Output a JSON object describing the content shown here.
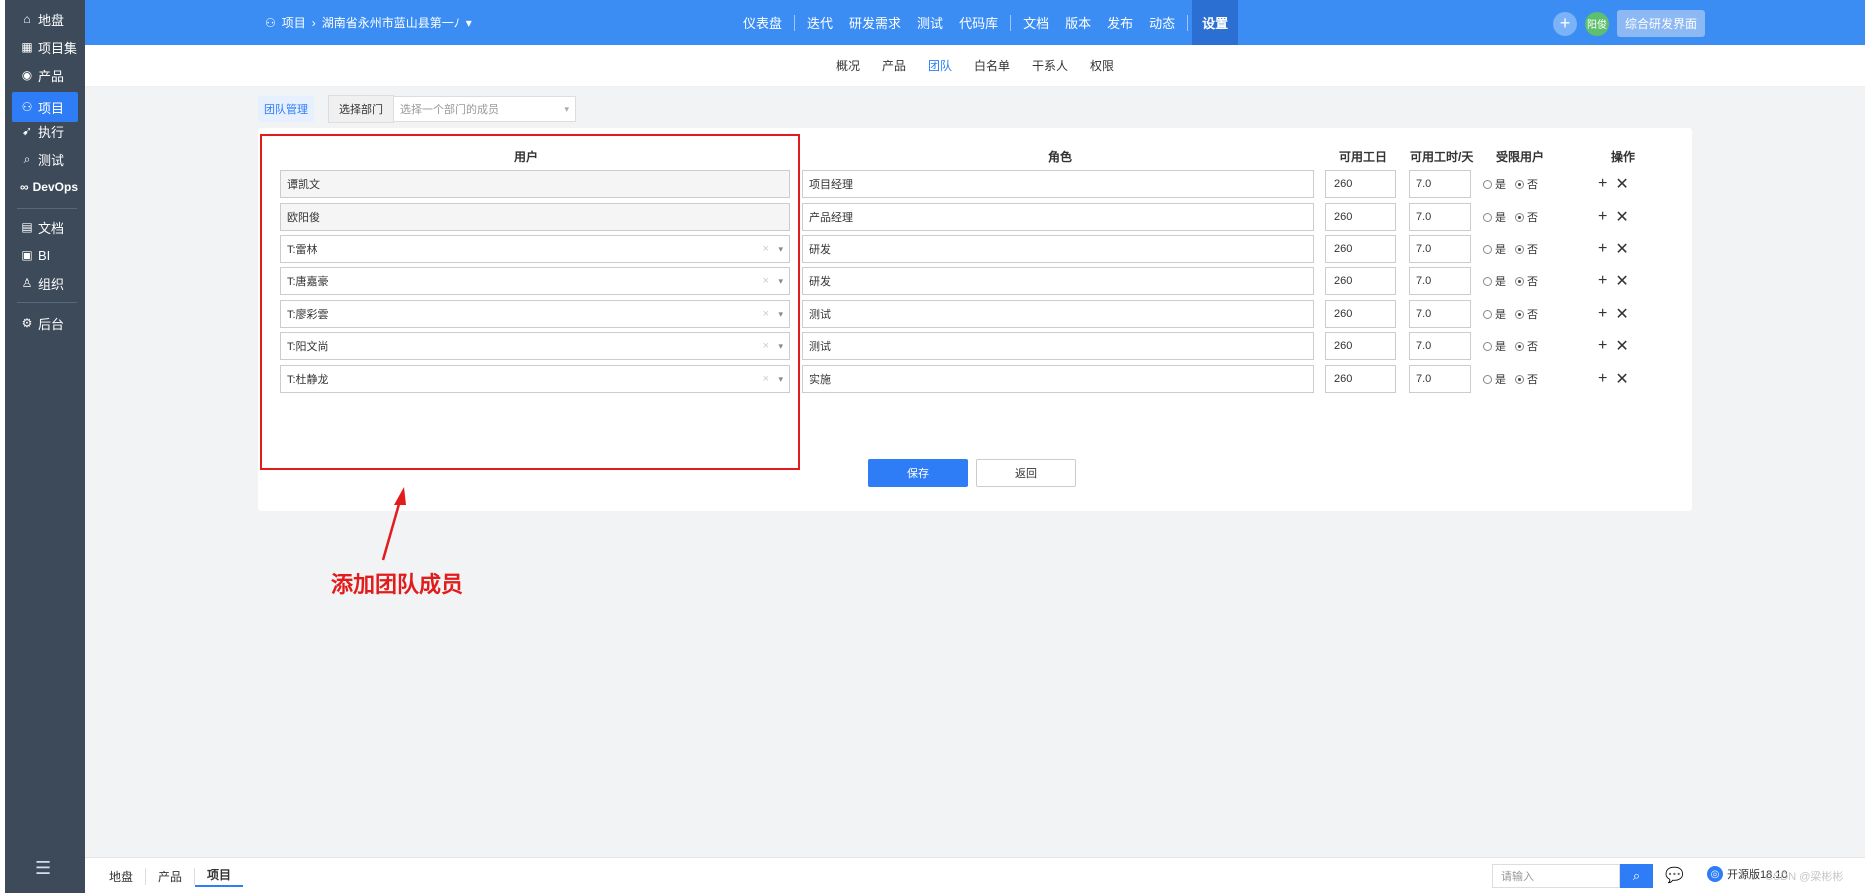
{
  "sidebar": {
    "items": [
      {
        "label": "地盘",
        "icon": "home-icon"
      },
      {
        "label": "项目集",
        "icon": "grid-icon"
      },
      {
        "label": "产品",
        "icon": "location-icon"
      },
      {
        "label": "项目",
        "icon": "project-icon"
      },
      {
        "label": "执行",
        "icon": "run-icon"
      },
      {
        "label": "测试",
        "icon": "search-icon"
      },
      {
        "label": "DevOps",
        "icon": "infinity-icon"
      },
      {
        "label": "文档",
        "icon": "document-icon"
      },
      {
        "label": "BI",
        "icon": "chart-icon"
      },
      {
        "label": "组织",
        "icon": "user-group-icon"
      },
      {
        "label": "后台",
        "icon": "gear-icon"
      }
    ],
    "active": "项目"
  },
  "header": {
    "breadcrumb_root": "项目",
    "breadcrumb_current": "湖南省永州市蓝山县第一ﾉ",
    "nav_items": [
      "仪表盘",
      "迭代",
      "研发需求",
      "测试",
      "代码库",
      "文档",
      "版本",
      "发布",
      "动态",
      "设置"
    ],
    "avatar_text": "阳俊",
    "workspace_button": "综合研发界面"
  },
  "subnav": {
    "tabs": [
      "概况",
      "产品",
      "团队",
      "白名单",
      "干系人",
      "权限"
    ],
    "active": "团队"
  },
  "toolbar": {
    "team_mgmt": "团队管理",
    "dept_label": "选择部门",
    "dept_placeholder": "选择一个部门的成员"
  },
  "table": {
    "headers": {
      "user": "用户",
      "role": "角色",
      "days": "可用工日",
      "hours": "可用工时/天",
      "limited": "受限用户",
      "ops": "操作"
    },
    "yes_label": "是",
    "no_label": "否",
    "rows": [
      {
        "user": "谭凯文",
        "role": "项目经理",
        "days": "260",
        "hours": "7.0",
        "readonly": true
      },
      {
        "user": "欧阳俊",
        "role": "产品经理",
        "days": "260",
        "hours": "7.0",
        "readonly": true
      },
      {
        "user": "T:雷林",
        "role": "研发",
        "days": "260",
        "hours": "7.0",
        "readonly": false
      },
      {
        "user": "T:唐嘉豪",
        "role": "研发",
        "days": "260",
        "hours": "7.0",
        "readonly": false
      },
      {
        "user": "T:廖彩雲",
        "role": "测试",
        "days": "260",
        "hours": "7.0",
        "readonly": false
      },
      {
        "user": "T:阳文尚",
        "role": "测试",
        "days": "260",
        "hours": "7.0",
        "readonly": false
      },
      {
        "user": "T:杜静龙",
        "role": "实施",
        "days": "260",
        "hours": "7.0",
        "readonly": false
      }
    ]
  },
  "buttons": {
    "save": "保存",
    "back": "返回"
  },
  "annotation": {
    "text": "添加团队成员",
    "color": "#e21b1b"
  },
  "footer": {
    "tabs": [
      "地盘",
      "产品",
      "项目"
    ],
    "active": "项目",
    "search_placeholder": "请输入",
    "version": "开源版18.10",
    "watermark": "CSDN @梁彬彬"
  },
  "colors": {
    "primary": "#2e7cf6",
    "header_bg": "#3b8df4",
    "sidebar_bg": "#3c4a5a"
  }
}
